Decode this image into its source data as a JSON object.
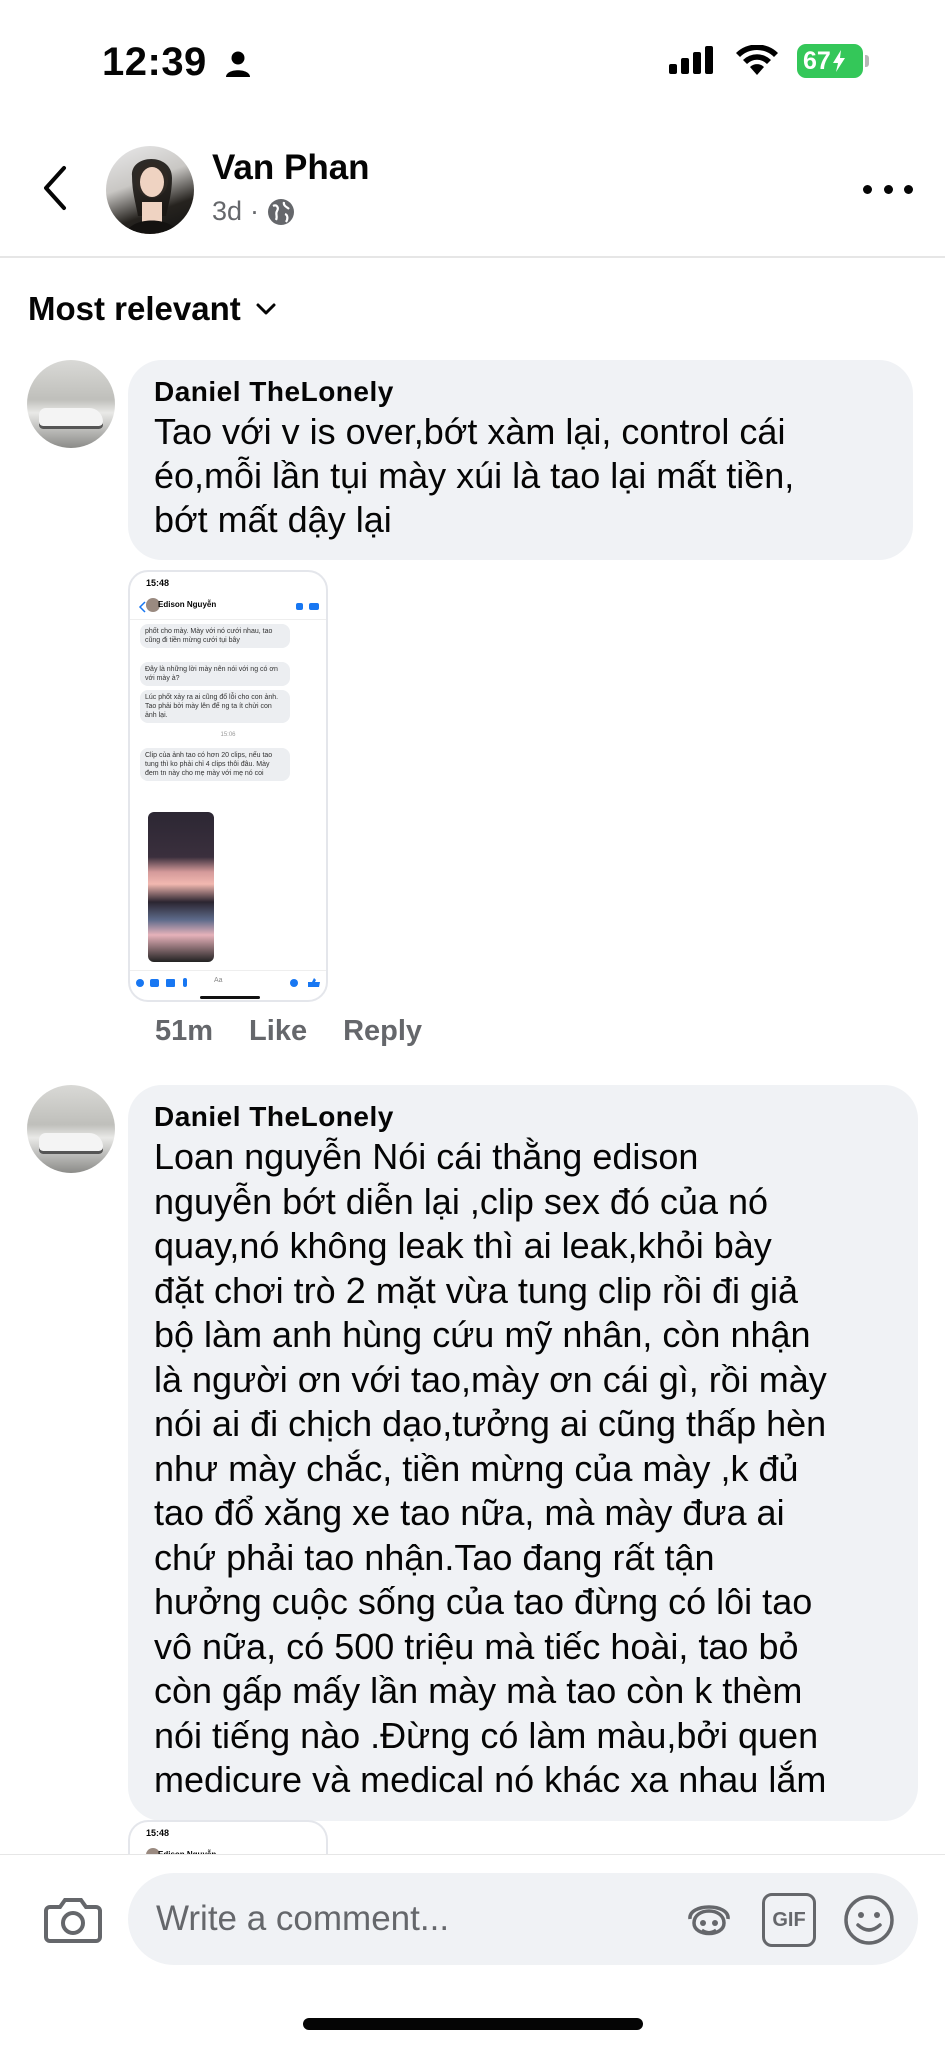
{
  "status_bar": {
    "time": "12:39",
    "battery": "67"
  },
  "header": {
    "name": "Van Phan",
    "time_ago": "3d",
    "separator": "·"
  },
  "sort": {
    "label": "Most relevant"
  },
  "comments": [
    {
      "author": "Daniel TheLonely",
      "text": "Tao với v is over,bớt xàm lại, control cái éo,mỗi lần tụi mày xúi là tao lại mất tiền, bớt mất dậy lại",
      "lines": [
        "Tao với v is over,bớt xàm lại, control cái",
        "éo,mỗi lần tụi mày xúi là tao lại mất tiền,",
        "bớt mất dậy lại"
      ],
      "attachment": {
        "status_time": "15:48",
        "chat_name": "Edison Nguyễn",
        "messages": [
          "phốt cho mày. Mày với nó cưới nhau, tao cũng đi tiền mừng cưới tụi bây",
          "Đây là những lời mày nên nói với ng có ơn với mày à?",
          "Lúc phốt xảy ra ai cũng đổ lỗi cho con ảnh. Tao phải bởi mày lên để ng ta ít chửi con ảnh lại.",
          "Clip của ảnh tao có hơn 20 clips, nếu tao tung thì ko phải chỉ 4 clips thôi đâu. Mày đem tn này cho mẹ mày với mẹ nó coi"
        ],
        "divider_time": "15:06",
        "input_placeholder": "Aa"
      },
      "time_ago": "51m",
      "like_label": "Like",
      "reply_label": "Reply"
    },
    {
      "author": "Daniel TheLonely",
      "lines": [
        "Loan nguyễn Nói cái thằng edison",
        "nguyễn  bớt diễn lại ,clip sex đó của nó",
        "quay,nó không leak thì ai leak,khỏi bày",
        "đặt chơi trò 2 mặt vừa tung clip rồi đi giả",
        "bộ làm anh hùng cứu mỹ nhân, còn nhận",
        "là người ơn với tao,mày ơn cái gì, rồi mày",
        "nói ai đi chịch dạo,tưởng ai cũng thấp hèn",
        "như mày chắc, tiền mừng của  mày ,k đủ",
        "tao đổ xăng  xe tao nữa, mà mày đưa ai",
        "chứ phải  tao nhận.Tao đang rất tận",
        "hưởng cuộc sống của  tao đừng có lôi tao",
        "vô nữa, có  500 triệu mà tiếc  hoài, tao bỏ",
        "còn gấp mấy lần mày mà tao còn k thèm",
        "nói  tiếng nào .Đừng có làm màu,bởi quen",
        "medicure và medical nó khác xa nhau lắm"
      ],
      "attachment": {
        "status_time": "15:48",
        "chat_name": "Edison Nguyễn"
      }
    }
  ],
  "composer": {
    "placeholder": "Write a comment...",
    "gif_label": "GIF"
  }
}
